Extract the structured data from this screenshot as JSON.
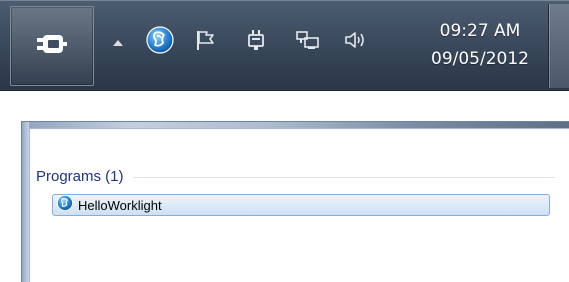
{
  "taskbar": {
    "clock": {
      "time": "09:27 AM",
      "date": "09/05/2012"
    },
    "tray_icons": [
      "show-hidden-icons-arrow",
      "worklight-icon",
      "action-center-flag-icon",
      "power-plug-icon",
      "network-icon",
      "volume-icon"
    ]
  },
  "start_menu": {
    "group_title": "Programs (1)",
    "results": [
      {
        "label": "HelloWorklight",
        "icon": "worklight-icon"
      }
    ]
  },
  "colors": {
    "taskbar": "#3e4d60",
    "group_title": "#1e3287",
    "selection_border": "#84acdd",
    "selection_fill": "#dce9f8",
    "worklight_blue": "#2a86d6"
  }
}
